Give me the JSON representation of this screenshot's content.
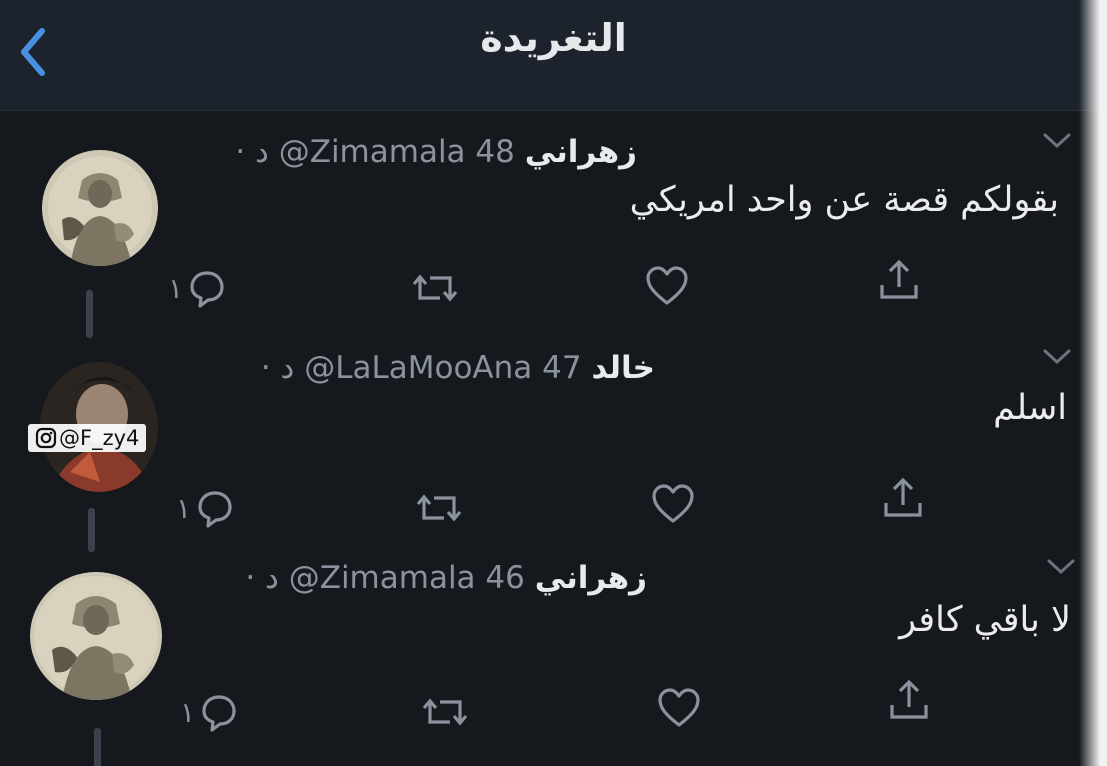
{
  "header": {
    "title": "التغريدة"
  },
  "tweets": [
    {
      "display_name": "زهراني",
      "handle": "@Zimamala",
      "time": "48 د ·",
      "text": "بقولكم قصة عن واحد امريكي",
      "reply_count": "١"
    },
    {
      "display_name": "خالد",
      "handle": "@LaLaMooAna",
      "time": "47 د ·",
      "text": "اسلم",
      "reply_count": "١"
    },
    {
      "display_name": "زهراني",
      "handle": "@Zimamala",
      "time": "46 د ·",
      "text": "لا باقي كافر",
      "reply_count": "١"
    }
  ],
  "watermark": {
    "text": "@F_zy4"
  },
  "icons": {
    "back": "chevron-left-icon",
    "more": "chevron-down-icon",
    "reply": "reply-bubble-icon",
    "retweet": "retweet-icon",
    "like": "heart-icon",
    "share": "share-icon",
    "instagram": "instagram-icon"
  },
  "colors": {
    "background": "#15181d",
    "header": "#1d232c",
    "accent": "#4a90e2",
    "secondary_text": "#8a939d"
  }
}
